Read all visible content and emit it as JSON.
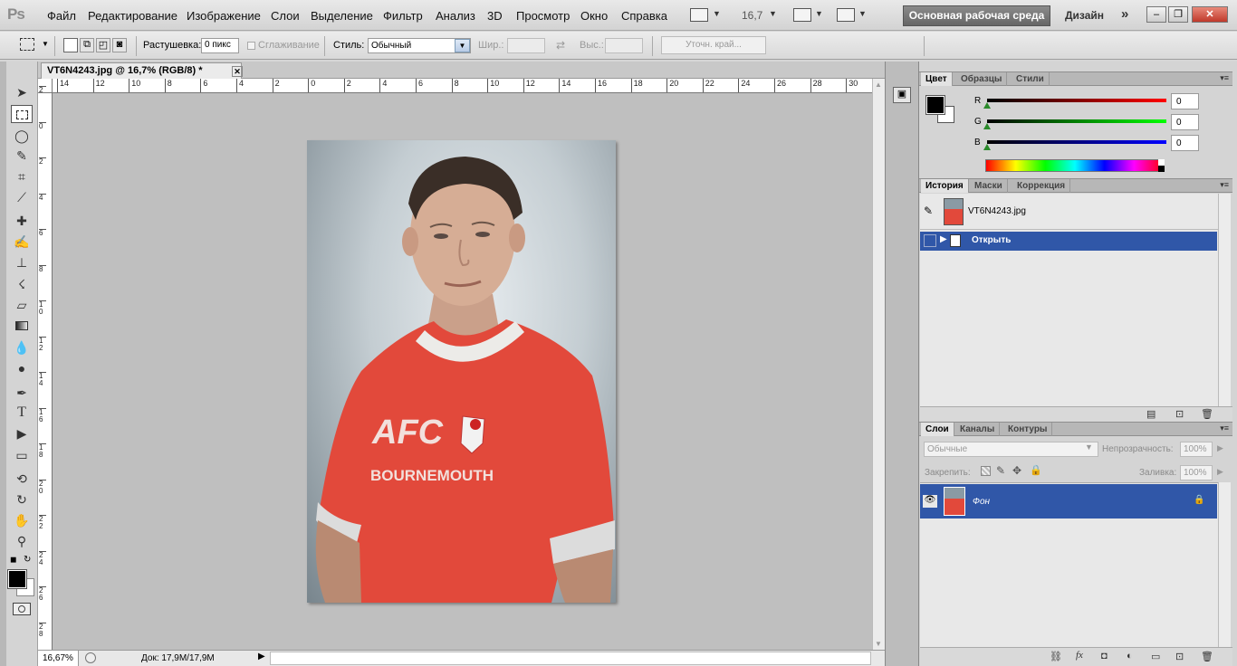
{
  "menubar": {
    "logo": "Ps",
    "items": [
      "Файл",
      "Редактирование",
      "Изображение",
      "Слои",
      "Выделение",
      "Фильтр",
      "Анализ",
      "3D",
      "Просмотр",
      "Окно",
      "Справка"
    ],
    "zoom": "16,7",
    "workspace_active": "Основная рабочая среда",
    "workspace_design": "Дизайн",
    "more": "»"
  },
  "options": {
    "feather_label": "Растушевка:",
    "feather_value": "0 пикс",
    "antialias_label": "Сглаживание",
    "style_label": "Стиль:",
    "style_value": "Обычный",
    "width_label": "Шир.:",
    "height_label": "Выс.:",
    "refine_edge": "Уточн. край..."
  },
  "document": {
    "tab_title": "VT6N4243.jpg @ 16,7% (RGB/8) *",
    "zoom_status": "16,67%",
    "doc_status": "Док: 17,9M/17,9M",
    "shirt_text_1": "AFC",
    "shirt_text_2": "BOURNEMOUTH"
  },
  "rulers": {
    "h": [
      "14",
      "12",
      "10",
      "8",
      "6",
      "4",
      "2",
      "0",
      "2",
      "4",
      "6",
      "8",
      "10",
      "12",
      "14",
      "16",
      "18",
      "20",
      "22",
      "24",
      "26",
      "28",
      "30"
    ],
    "v": [
      "2",
      "0",
      "2",
      "4",
      "6",
      "8",
      "1 0",
      "1 2",
      "1 4",
      "1 6",
      "1 8",
      "2 0",
      "2 2",
      "2 4",
      "2 6",
      "2 8"
    ]
  },
  "color_panel": {
    "tabs": [
      "Цвет",
      "Образцы",
      "Стили"
    ],
    "r_label": "R",
    "g_label": "G",
    "b_label": "B",
    "r_value": "0",
    "g_value": "0",
    "b_value": "0",
    "fg_color": "#000000",
    "bg_color": "#ffffff"
  },
  "history_panel": {
    "tabs": [
      "История",
      "Маски",
      "Коррекция"
    ],
    "snapshot": "VT6N4243.jpg",
    "steps": [
      "Открыть"
    ]
  },
  "layers_panel": {
    "tabs": [
      "Слои",
      "Каналы",
      "Контуры"
    ],
    "blend_mode": "Обычные",
    "opacity_label": "Непрозрачность:",
    "opacity_value": "100%",
    "lock_label": "Закрепить:",
    "fill_label": "Заливка:",
    "fill_value": "100%",
    "layers": [
      "Фон"
    ]
  },
  "colors": {
    "selection_blue": "#3057a8",
    "shirt_red": "#e04a3c"
  }
}
